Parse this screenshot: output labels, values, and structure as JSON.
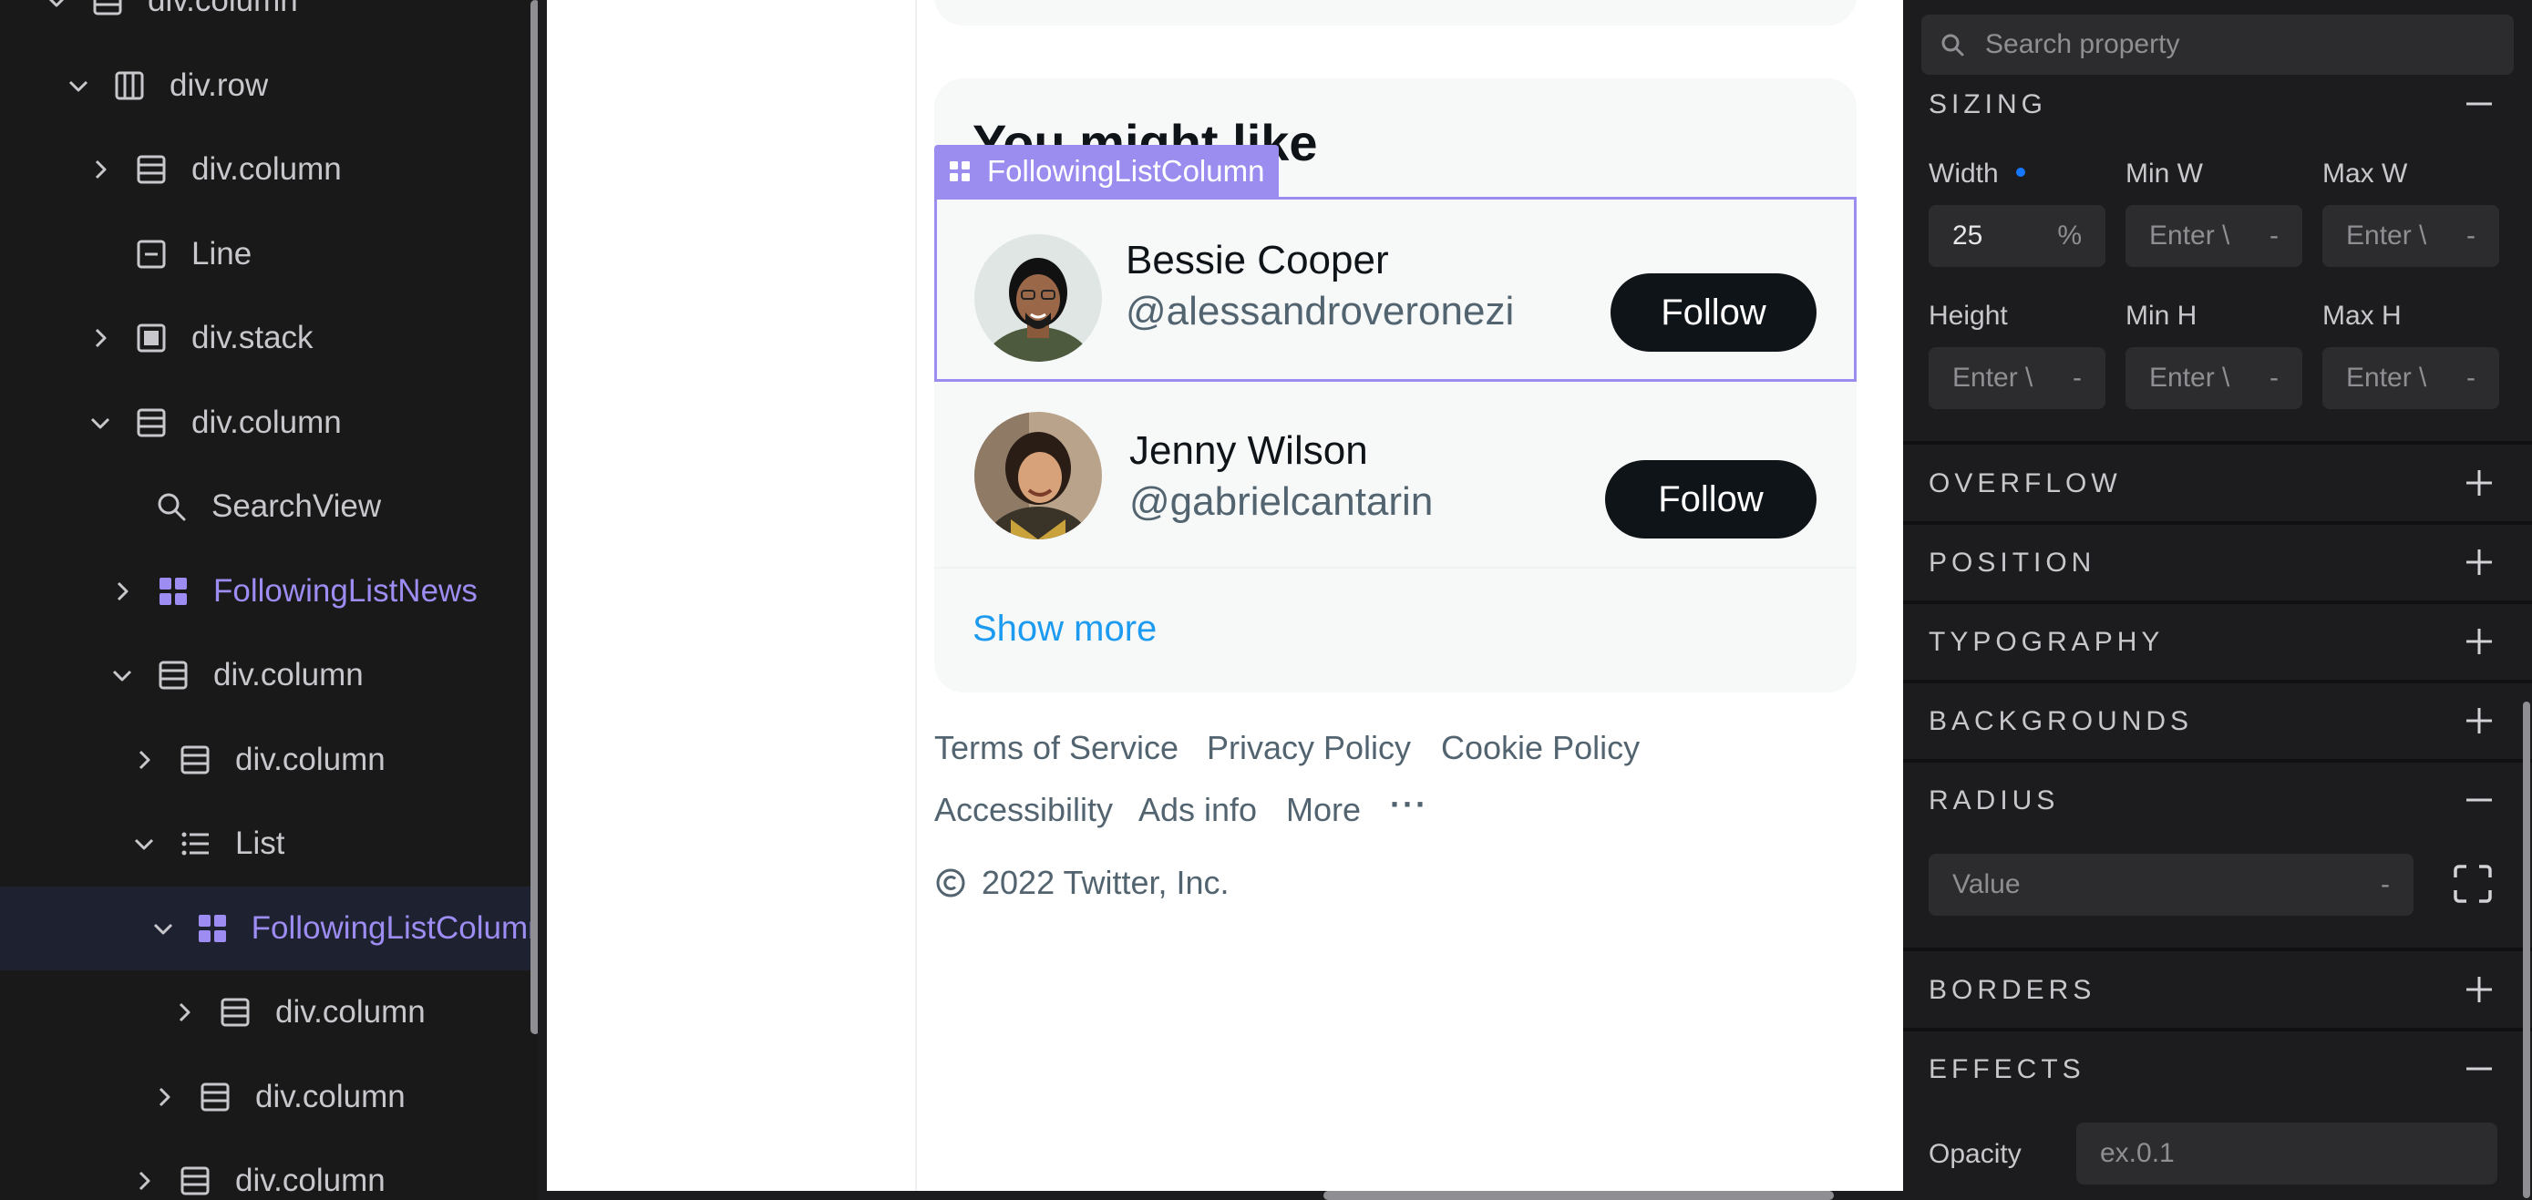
{
  "tree": {
    "items": [
      {
        "label": "div.column",
        "icon": "column-icon",
        "chevron": "down",
        "component": false
      },
      {
        "label": "div.row",
        "icon": "row-icon",
        "chevron": "down",
        "component": false
      },
      {
        "label": "div.column",
        "icon": "column-icon",
        "chevron": "right",
        "component": false
      },
      {
        "label": "Line",
        "icon": "line-icon",
        "chevron": "none",
        "component": false
      },
      {
        "label": "div.stack",
        "icon": "stack-icon",
        "chevron": "right",
        "component": false
      },
      {
        "label": "div.column",
        "icon": "column-icon",
        "chevron": "down",
        "component": false
      },
      {
        "label": "SearchView",
        "icon": "search-icon",
        "chevron": "none",
        "component": false
      },
      {
        "label": "FollowingListNews",
        "icon": "component-icon",
        "chevron": "right",
        "component": true
      },
      {
        "label": "div.column",
        "icon": "column-icon",
        "chevron": "down",
        "component": false
      },
      {
        "label": "div.column",
        "icon": "column-icon",
        "chevron": "right",
        "component": false
      },
      {
        "label": "List",
        "icon": "list-icon",
        "chevron": "down",
        "component": false
      },
      {
        "label": "FollowingListColumn",
        "icon": "component-icon",
        "chevron": "down",
        "component": true,
        "selected": true
      },
      {
        "label": "div.column",
        "icon": "column-icon",
        "chevron": "right",
        "component": false
      },
      {
        "label": "div.column",
        "icon": "column-icon",
        "chevron": "right",
        "component": false
      },
      {
        "label": "div.column",
        "icon": "column-icon",
        "chevron": "right",
        "component": false
      }
    ]
  },
  "canvas": {
    "card_title": "You might like",
    "selection_tag": "FollowingListColumn",
    "users": [
      {
        "name": "Bessie Cooper",
        "handle": "@alessandroveronezi",
        "button": "Follow"
      },
      {
        "name": "Jenny Wilson",
        "handle": "@gabrielcantarin",
        "button": "Follow"
      }
    ],
    "show_more": "Show more",
    "footer_links": [
      "Terms of Service",
      "Privacy Policy",
      "Cookie Policy",
      "Accessibility",
      "Ads info",
      "More",
      "···"
    ],
    "copyright": "2022 Twitter, Inc."
  },
  "props": {
    "search_placeholder": "Search property",
    "sizing": {
      "title": "SIZING",
      "width_label": "Width",
      "width_value": "25",
      "width_unit": "%",
      "min_w_label": "Min W",
      "max_w_label": "Max W",
      "height_label": "Height",
      "min_h_label": "Min H",
      "max_h_label": "Max H",
      "enter_placeholder": "Enter \\",
      "dash": "-"
    },
    "sections": {
      "overflow": "OVERFLOW",
      "position": "POSITION",
      "typography": "TYPOGRAPHY",
      "backgrounds": "BACKGROUNDS",
      "radius": "RADIUS",
      "borders": "BORDERS",
      "effects": "EFFECTS"
    },
    "radius_placeholder": "Value",
    "radius_dash": "-",
    "opacity_label": "Opacity",
    "opacity_placeholder": "ex.0.1"
  },
  "colors": {
    "accent_purple": "#9b8cf0",
    "link_blue": "#1d9bf0",
    "follow_button": "#0f1419"
  }
}
